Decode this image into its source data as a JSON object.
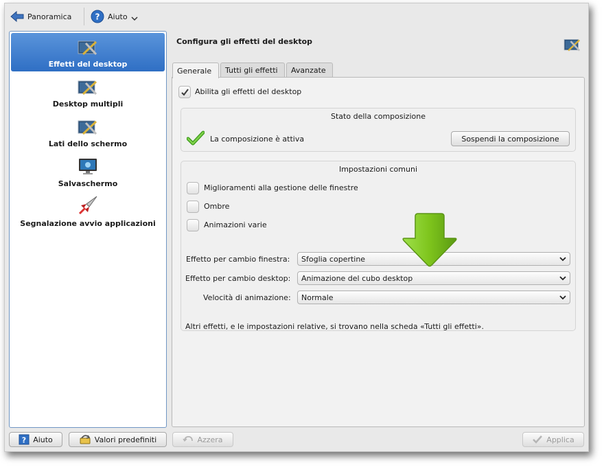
{
  "toolbar": {
    "overview_label": "Panoramica",
    "help_label": "Aiuto"
  },
  "sidebar": {
    "items": [
      {
        "label": "Effetti del desktop",
        "icon": "desktop-effects-icon"
      },
      {
        "label": "Desktop multipli",
        "icon": "multiple-desktops-icon"
      },
      {
        "label": "Lati dello schermo",
        "icon": "screen-edges-icon"
      },
      {
        "label": "Salvaschermo",
        "icon": "screensaver-icon"
      },
      {
        "label": "Segnalazione avvio applicazioni",
        "icon": "launch-feedback-rocket-icon"
      }
    ]
  },
  "main": {
    "title": "Configura gli effetti del desktop",
    "tabs": [
      {
        "label": "Generale"
      },
      {
        "label": "Tutti gli effetti"
      },
      {
        "label": "Avanzate"
      }
    ],
    "enable_effects_label": "Abilita gli effetti del desktop",
    "composition": {
      "title": "Stato della composizione",
      "status": "La composizione è attiva",
      "suspend_label": "Sospendi la composizione"
    },
    "common": {
      "title": "Impostazioni comuni",
      "checkboxes": [
        {
          "label": "Miglioramenti alla gestione delle finestre"
        },
        {
          "label": "Ombre"
        },
        {
          "label": "Animazioni varie"
        }
      ],
      "window_switch_label": "Effetto per cambio finestra:",
      "window_switch_value": "Sfoglia copertine",
      "desktop_switch_label": "Effetto per cambio desktop:",
      "desktop_switch_value": "Animazione del cubo desktop",
      "anim_speed_label": "Velocità di animazione:",
      "anim_speed_value": "Normale",
      "footer_text": "Altri effetti, e le impostazioni relative, si trovano nella scheda «Tutti gli effetti»."
    }
  },
  "bottom": {
    "help_label": "Aiuto",
    "defaults_label": "Valori predefiniti",
    "reset_label": "Azzera",
    "apply_label": "Applica"
  },
  "colors": {
    "accent": "#2f6fc4",
    "arrow_green": "#7ec41c"
  }
}
